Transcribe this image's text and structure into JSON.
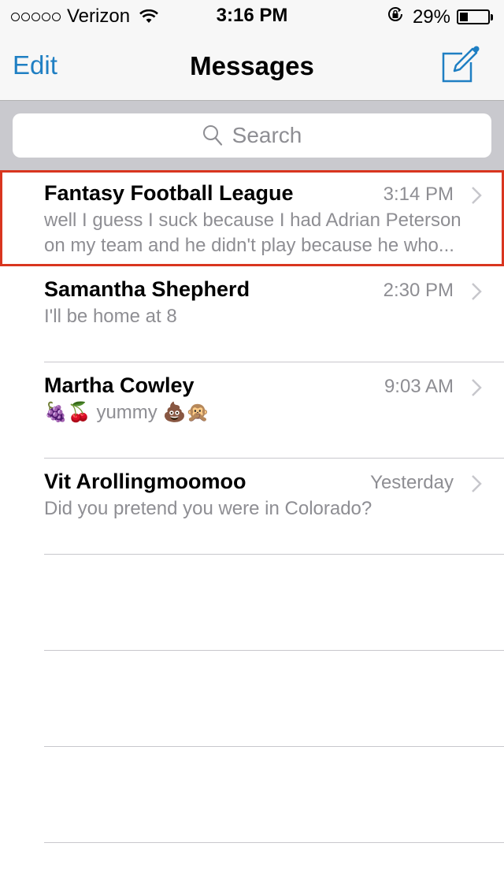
{
  "status_bar": {
    "signal_dots": 5,
    "carrier": "Verizon",
    "time": "3:16 PM",
    "battery_percent_label": "29%",
    "battery_level": 0.29,
    "icons": [
      "signal-dots-icon",
      "wifi-icon",
      "rotation-lock-icon",
      "battery-icon"
    ]
  },
  "nav": {
    "edit_label": "Edit",
    "title": "Messages",
    "compose_icon": "compose-icon"
  },
  "search": {
    "placeholder": "Search"
  },
  "conversations": [
    {
      "name": "Fantasy Football League",
      "time": "3:14 PM",
      "preview": "well I guess I suck because I had Adrian Peterson on my team and he didn't play because he who...",
      "highlighted": true
    },
    {
      "name": "Samantha Shepherd",
      "time": "2:30 PM",
      "preview": "I'll be home at 8",
      "highlighted": false
    },
    {
      "name": "Martha Cowley",
      "time": "9:03 AM",
      "preview_parts": [
        "🍇",
        "🍒",
        "yummy",
        "💩",
        "🙊"
      ],
      "highlighted": false
    },
    {
      "name": "Vit Arollingmoomoo",
      "time": "Yesterday",
      "preview": "Did you pretend you were in Colorado?",
      "highlighted": false
    }
  ],
  "colors": {
    "accent": "#1f7fc3",
    "highlight_border": "#d9351f",
    "secondary_text": "#8e8e93",
    "separator": "#c8c7cc",
    "search_bg": "#c9c9ce"
  }
}
